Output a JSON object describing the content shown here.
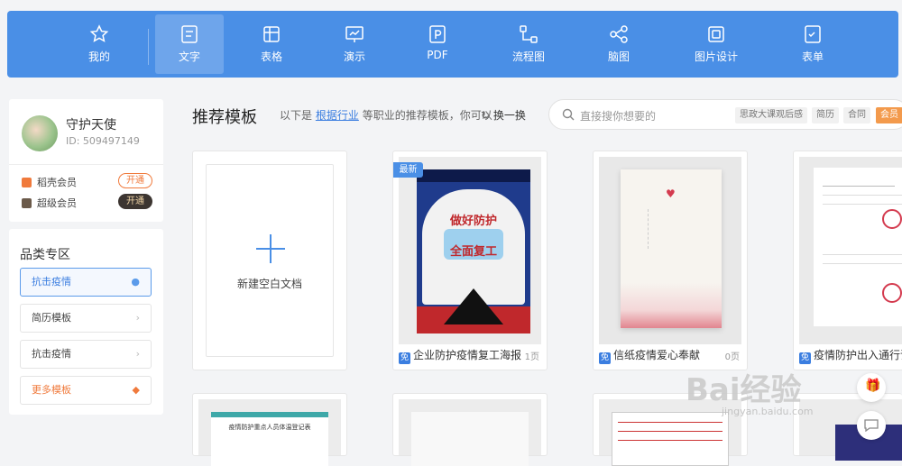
{
  "toolbar": {
    "tabs": [
      {
        "label": "我的",
        "icon": "star-icon"
      },
      {
        "label": "文字",
        "icon": "document-icon",
        "active": true
      },
      {
        "label": "表格",
        "icon": "table-icon"
      },
      {
        "label": "演示",
        "icon": "presentation-icon"
      },
      {
        "label": "PDF",
        "icon": "pdf-icon"
      },
      {
        "label": "流程图",
        "icon": "flowchart-icon"
      },
      {
        "label": "脑图",
        "icon": "mindmap-icon"
      },
      {
        "label": "图片设计",
        "icon": "image-design-icon"
      },
      {
        "label": "表单",
        "icon": "form-icon"
      }
    ]
  },
  "user": {
    "name": "守护天使",
    "id_text": "ID: 509497149",
    "memberships": [
      {
        "label": "稻壳会员",
        "button": "开通",
        "color": "#f07a3c"
      },
      {
        "label": "超级会员",
        "button": "开通",
        "color": "#6b5a4a"
      }
    ]
  },
  "categories": {
    "title": "品类专区",
    "items": [
      {
        "label": "抗击疫情",
        "active": true
      },
      {
        "label": "简历模板"
      },
      {
        "label": "抗击疫情"
      },
      {
        "label": "更多模板",
        "accent": true
      }
    ]
  },
  "recommend": {
    "title": "推荐模板",
    "hint_prefix": "以下是",
    "hint_link": "根据行业",
    "hint_suffix": "等职业的推荐模板，你可以",
    "refresh_label": "换一换"
  },
  "search": {
    "placeholder": "直接搜你想要的",
    "chips": [
      "思政大课观后感",
      "简历",
      "合同",
      "会员"
    ]
  },
  "templates": [
    {
      "label": "新建空白文档",
      "type": "blank"
    },
    {
      "label": "企业防护疫情复工海报",
      "pages": "1页",
      "badge": "最新",
      "free": "免",
      "poster_title_1": "做好防护",
      "poster_title_2": "全面复工"
    },
    {
      "label": "信纸疫情爱心奉献",
      "pages": "0页",
      "free": "免"
    },
    {
      "label": "疫情防护出入通行证",
      "pages": "",
      "free": "免"
    }
  ],
  "second_row": {
    "card1_title": "疫情防护重点人员体温登记表"
  },
  "watermark": {
    "text": "Bai经验",
    "url": "jingyan.baidu.com"
  }
}
